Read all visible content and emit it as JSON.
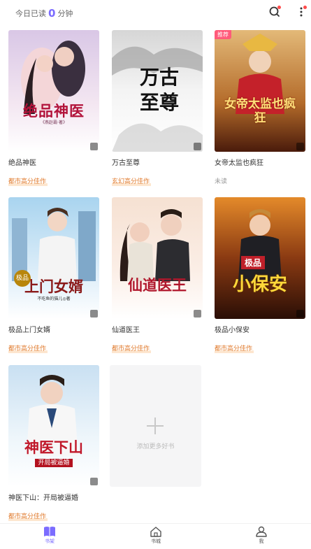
{
  "header": {
    "today_prefix": "今日已读",
    "today_minutes": "0",
    "today_suffix": "分钟",
    "icons": [
      "search-icon",
      "more-vertical-icon"
    ]
  },
  "books": [
    {
      "title": "绝品神医",
      "tag": "都市高分佳作",
      "cover_text": "绝品神医",
      "cover_sub": "《燕赵霸·著》",
      "badge": ""
    },
    {
      "title": "万古至尊",
      "tag": "玄幻高分佳作",
      "cover_text": "万古至尊",
      "cover_sub": "",
      "badge": ""
    },
    {
      "title": "女帝太监也疯狂",
      "tag": "未读",
      "cover_text": "女帝太监也疯狂",
      "cover_sub": "",
      "badge": "推荐"
    },
    {
      "title": "极品上门女婿",
      "tag": "都市高分佳作",
      "cover_text": "上门女婿",
      "cover_sub": "不吃鱼的猫儿◎著",
      "badge": ""
    },
    {
      "title": "仙道医王",
      "tag": "都市高分佳作",
      "cover_text": "仙道医王",
      "cover_sub": "",
      "badge": ""
    },
    {
      "title": "极品小保安",
      "tag": "都市高分佳作",
      "cover_text": "小保安",
      "cover_sub": "极品",
      "badge": ""
    },
    {
      "title": "神医下山：开局被逼婚",
      "tag": "都市高分佳作",
      "cover_text": "神医下山",
      "cover_sub": "开局被逼婚",
      "badge": ""
    }
  ],
  "add_more": {
    "label": "添加更多好书"
  },
  "tabbar": {
    "items": [
      {
        "label": "书架",
        "icon": "bookshelf-icon",
        "active": true
      },
      {
        "label": "书城",
        "icon": "home-icon",
        "active": false
      },
      {
        "label": "我",
        "icon": "user-icon",
        "active": false
      }
    ]
  },
  "colors": {
    "accent": "#7b6cff",
    "tag": "#e07a2c",
    "badge": "#ff5a7a"
  }
}
